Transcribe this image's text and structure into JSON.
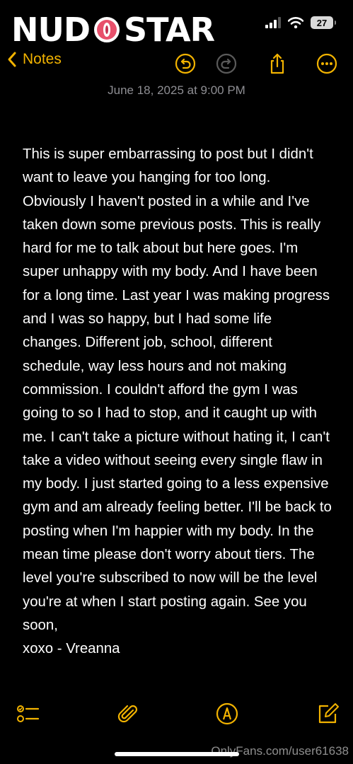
{
  "watermark": {
    "logo_text": "NUDOSTAR",
    "footer_text": "OnlyFans.com/user61638"
  },
  "status_bar": {
    "battery_level": "27",
    "icons": [
      "signal-icon",
      "wifi-icon",
      "battery-icon"
    ]
  },
  "toolbar": {
    "back_label": "Notes",
    "icons": [
      "undo-icon",
      "redo-icon",
      "share-icon",
      "more-icon"
    ]
  },
  "note": {
    "date": "June 18, 2025 at 9:00 PM",
    "body": "This is super embarrassing to post but I didn't want to leave you hanging for too long. Obviously I haven't posted in a while and I've taken down some previous posts. This is really hard for me to talk about but here goes. I'm super unhappy with my body. And I have been for a long time. Last year I was making progress and I was so happy, but I had some life changes. Different job, school, different schedule, way less hours and not making commission. I couldn't afford the gym I was going to so I had to stop, and it caught up with me. I can't take a picture without hating it, I can't take a video without seeing every single flaw in my body. I just started going to a less expensive gym and am already feeling better. I'll be back to posting when I'm happier with my body. In the mean time please don't worry about tiers. The level you're subscribed to now will be the level you're at when I start posting again. See you soon,\nxoxo - Vreanna"
  },
  "bottom_bar": {
    "icons": [
      "checklist-icon",
      "attachment-icon",
      "markup-icon",
      "compose-icon"
    ]
  },
  "colors": {
    "accent": "#f2b300",
    "background": "#000000",
    "secondary_text": "#8e8e93"
  }
}
